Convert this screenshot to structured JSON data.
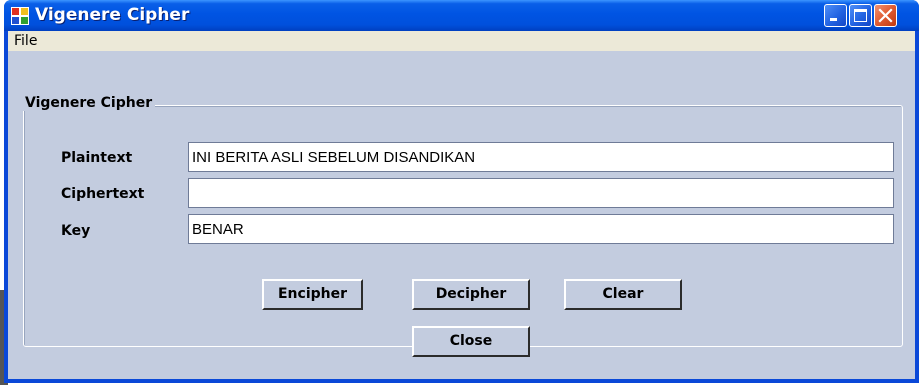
{
  "window": {
    "title": "Vigenere Cipher"
  },
  "menu": {
    "items": [
      "File"
    ]
  },
  "group": {
    "title": "Vigenere Cipher"
  },
  "fields": {
    "plaintext": {
      "label": "Plaintext",
      "value": "INI BERITA ASLI SEBELUM DISANDIKAN"
    },
    "ciphertext": {
      "label": "Ciphertext",
      "value": ""
    },
    "key": {
      "label": "Key",
      "value": "BENAR"
    }
  },
  "buttons": {
    "encipher": "Encipher",
    "decipher": "Decipher",
    "clear": "Clear",
    "close": "Close"
  },
  "colors": {
    "titlebar": "#0054e3",
    "client_bg": "#c3ccdf",
    "close_button": "#e05a30"
  },
  "icons": {
    "app": "app-window-icon",
    "minimize": "minimize-icon",
    "maximize": "maximize-icon",
    "close": "close-icon"
  }
}
